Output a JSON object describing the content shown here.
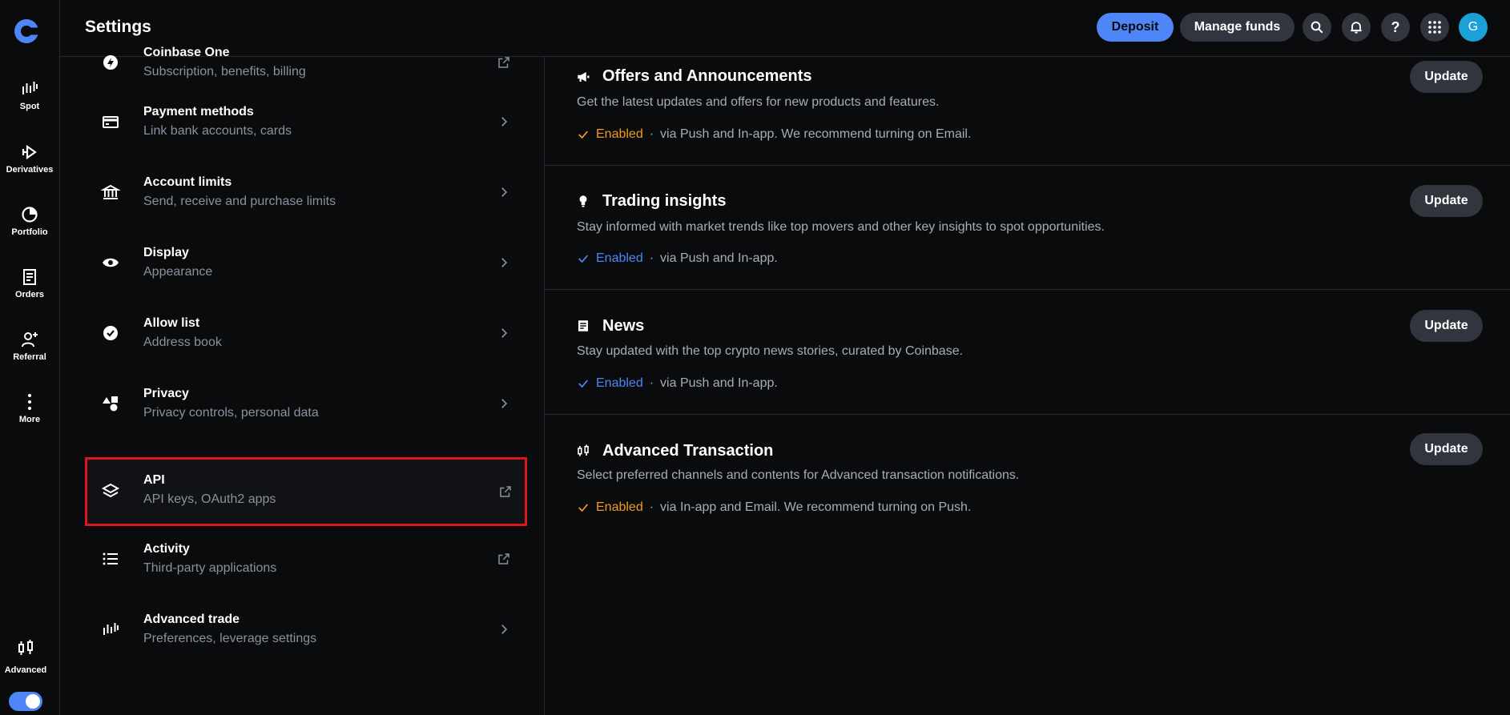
{
  "header": {
    "title": "Settings",
    "deposit_label": "Deposit",
    "manage_funds_label": "Manage funds",
    "avatar_initial": "G"
  },
  "rail": {
    "items": [
      {
        "label": "Spot",
        "icon": "spot-chart-icon"
      },
      {
        "label": "Derivatives",
        "icon": "derivatives-icon"
      },
      {
        "label": "Portfolio",
        "icon": "pie-chart-icon"
      },
      {
        "label": "Orders",
        "icon": "document-icon"
      },
      {
        "label": "Referral",
        "icon": "add-user-icon"
      },
      {
        "label": "More",
        "icon": "more-vertical-icon"
      }
    ],
    "advanced_label": "Advanced",
    "advanced_toggle_on": true
  },
  "settings_list": [
    {
      "title": "Coinbase One",
      "subtitle": "Subscription, benefits, billing",
      "icon": "coinbase-one-icon",
      "action": "external"
    },
    {
      "title": "Payment methods",
      "subtitle": "Link bank accounts, cards",
      "icon": "card-icon",
      "action": "chevron"
    },
    {
      "title": "Account limits",
      "subtitle": "Send, receive and purchase limits",
      "icon": "bank-icon",
      "action": "chevron"
    },
    {
      "title": "Display",
      "subtitle": "Appearance",
      "icon": "eye-icon",
      "action": "chevron"
    },
    {
      "title": "Allow list",
      "subtitle": "Address book",
      "icon": "check-circle-icon",
      "action": "chevron"
    },
    {
      "title": "Privacy",
      "subtitle": "Privacy controls, personal data",
      "icon": "shapes-icon",
      "action": "chevron"
    },
    {
      "title": "API",
      "subtitle": "API keys, OAuth2 apps",
      "icon": "layers-icon",
      "action": "external",
      "highlighted": true
    },
    {
      "title": "Activity",
      "subtitle": "Third-party applications",
      "icon": "list-icon",
      "action": "external"
    },
    {
      "title": "Advanced trade",
      "subtitle": "Preferences, leverage settings",
      "icon": "advanced-trade-icon",
      "action": "chevron"
    }
  ],
  "notifications": [
    {
      "title": "Offers and Announcements",
      "description": "Get the latest updates and offers for new products and features.",
      "status": "Enabled",
      "status_color": "#f59b1c",
      "via": "via Push and In-app. We recommend turning on Email.",
      "icon": "megaphone-icon",
      "button": "Update"
    },
    {
      "title": "Trading insights",
      "description": "Stay informed with market trends like top movers and other key insights to spot opportunities.",
      "status": "Enabled",
      "status_color": "#4f86f7",
      "via": "via Push and In-app.",
      "icon": "lightbulb-icon",
      "button": "Update"
    },
    {
      "title": "News",
      "description": "Stay updated with the top crypto news stories, curated by Coinbase.",
      "status": "Enabled",
      "status_color": "#4f86f7",
      "via": "via Push and In-app.",
      "icon": "newspaper-icon",
      "button": "Update"
    },
    {
      "title": "Advanced Transaction",
      "description": "Select preferred channels and contents for Advanced transaction notifications.",
      "status": "Enabled",
      "status_color": "#f59b1c",
      "via": "via In-app and Email. We recommend turning on Push.",
      "icon": "candlestick-icon",
      "button": "Update"
    }
  ],
  "separator": "·",
  "colors": {
    "accent": "#4f86f7",
    "warning": "#f59b1c",
    "highlight_border": "#e0151a",
    "background": "#0a0b0d"
  }
}
